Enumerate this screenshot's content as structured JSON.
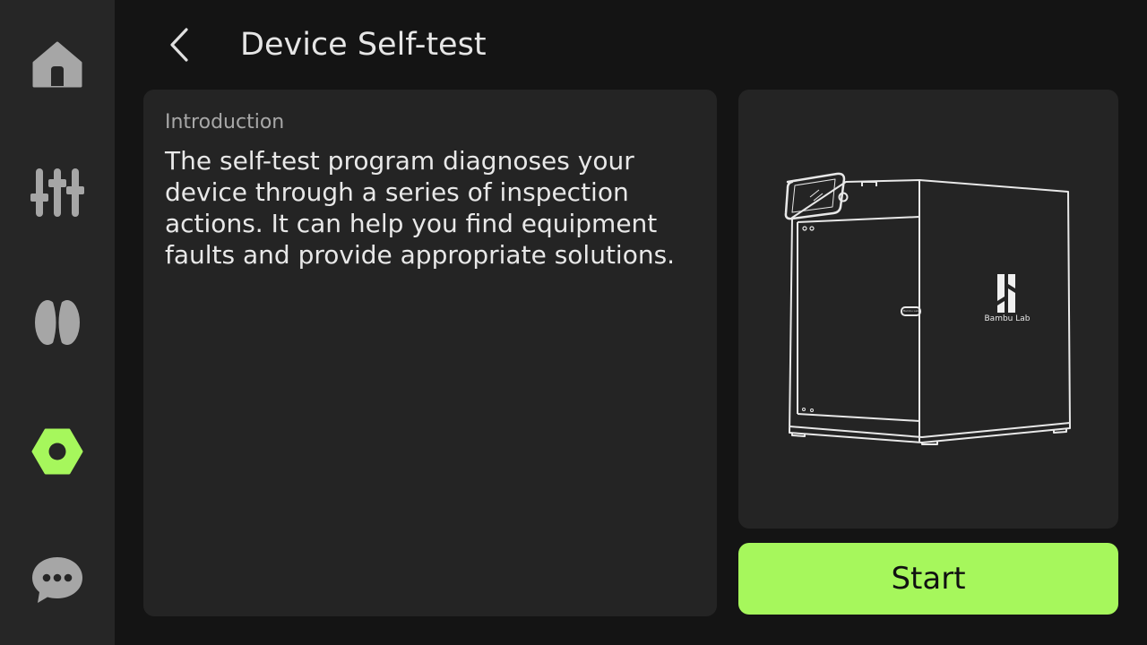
{
  "header": {
    "title": "Device Self-test"
  },
  "sidebar": {
    "items": [
      {
        "icon": "home-icon",
        "active": false
      },
      {
        "icon": "controls-icon",
        "active": false
      },
      {
        "icon": "filament-icon",
        "active": false
      },
      {
        "icon": "settings-icon",
        "active": true
      },
      {
        "icon": "messages-icon",
        "active": false
      }
    ]
  },
  "intro": {
    "heading": "Introduction",
    "body": "The self-test program diagnoses your device through a series of inspection actions. It can help you find equipment faults and provide appropriate solutions."
  },
  "device_image": {
    "brand": "Bambu Lab",
    "door_label": "Bambu Lab"
  },
  "actions": {
    "start_label": "Start"
  },
  "colors": {
    "background": "#141414",
    "sidebar": "#262626",
    "card": "#242424",
    "accent": "#a6f75c",
    "icon_inactive": "#a6a6a6"
  }
}
